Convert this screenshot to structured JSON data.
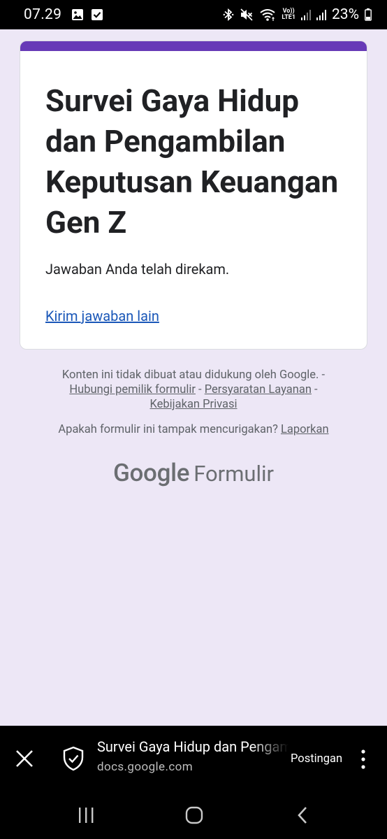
{
  "status_bar": {
    "time": "07.29",
    "battery_percent": "23%",
    "left_icons": [
      "image-icon",
      "check-box-icon"
    ],
    "right_icons": [
      "bluetooth-icon",
      "mute-icon",
      "wifi-icon",
      "volte-icon",
      "signal-icon",
      "signal-icon",
      "battery-icon"
    ],
    "volte_text_top": "Vo))",
    "volte_text_bottom": "LTE1"
  },
  "form": {
    "title": "Survei Gaya Hidup dan Pengambilan Keputusan Keuangan Gen Z",
    "confirmation_message": "Jawaban Anda telah direkam.",
    "submit_another_link": "Kirim jawaban lain",
    "accent_color": "#673ab7",
    "background_color": "#ede7f6"
  },
  "footer": {
    "disclaimer": "Konten ini tidak dibuat atau didukung oleh Google. -",
    "contact_owner": "Hubungi pemilik formulir",
    "separator": " - ",
    "terms": "Persyaratan Layanan",
    "separator_end": " -",
    "privacy": "Kebijakan Privasi",
    "report_question": "Apakah formulir ini tampak mencurigakan?",
    "report_link": "Laporkan",
    "brand_google": "Google",
    "brand_product": "Formulir"
  },
  "browser_bar": {
    "page_title": "Survei Gaya Hidup dan Pengambilan Keputusan Keuangan Gen Z",
    "url": "docs.google.com",
    "post_button": "Postingan",
    "icons": [
      "close-icon",
      "shield-check-icon",
      "more-vert-icon"
    ]
  },
  "nav_bar": {
    "buttons": [
      "recent-apps-icon",
      "home-icon",
      "back-icon"
    ]
  }
}
